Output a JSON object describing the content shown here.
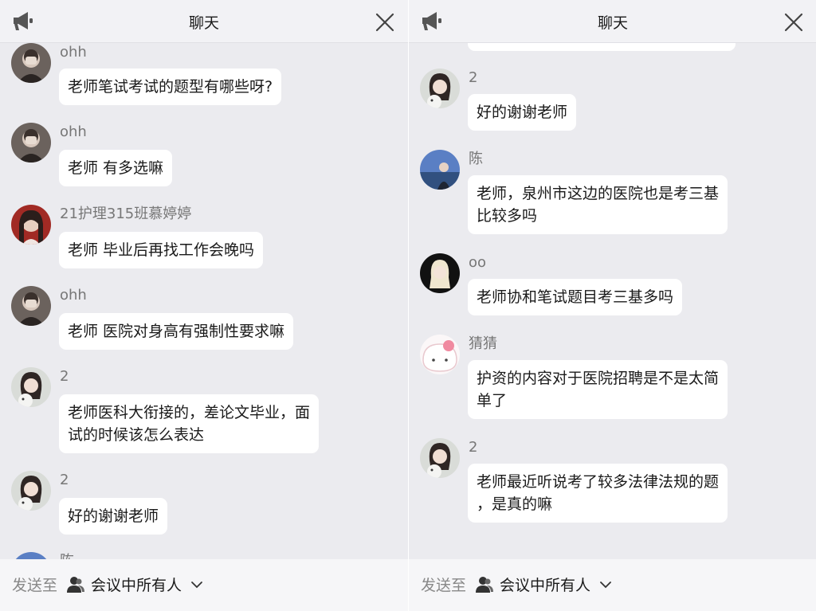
{
  "left_panel": {
    "header": {
      "title": "聊天"
    },
    "messages": [
      {
        "sender": "ohh",
        "lines": [
          "老师笔试考试的题型有哪些呀?"
        ]
      },
      {
        "sender": "ohh",
        "lines": [
          "老师 有多选嘛"
        ]
      },
      {
        "sender": "21护理315班慕婷婷",
        "lines": [
          "老师 毕业后再找工作会晚吗"
        ]
      },
      {
        "sender": "ohh",
        "lines": [
          "老师 医院对身高有强制性要求嘛"
        ]
      },
      {
        "sender": "2",
        "lines": [
          "老师医科大衔接的，差论文毕业，面",
          "试的时候该怎么表达"
        ]
      },
      {
        "sender": "2",
        "lines": [
          "好的谢谢老师"
        ]
      },
      {
        "sender": "陈",
        "lines": []
      }
    ],
    "footer": {
      "send_to_label": "发送至",
      "target": "会议中所有人"
    }
  },
  "right_panel": {
    "header": {
      "title": "聊天"
    },
    "messages": [
      {
        "sender": "2",
        "lines": [
          "好的谢谢老师"
        ]
      },
      {
        "sender": "陈",
        "lines": [
          "老师，泉州市这边的医院也是考三基",
          "比较多吗"
        ]
      },
      {
        "sender": "oo",
        "lines": [
          "老师协和笔试题目考三基多吗"
        ]
      },
      {
        "sender": "猜猜",
        "lines": [
          "护资的内容对于医院招聘是不是太简",
          "单了"
        ]
      },
      {
        "sender": "2",
        "lines": [
          "老师最近听说考了较多法律法规的题",
          "，是真的嘛"
        ]
      }
    ],
    "footer": {
      "send_to_label": "发送至",
      "target": "会议中所有人"
    }
  },
  "icons": {
    "header_left": "megaphone-icon",
    "header_right": "close-icon",
    "footer_person": "person-icon",
    "footer_chevron": "chevron-down-icon"
  },
  "colors": {
    "panel_bg": "#ebebef",
    "bubble_bg": "#ffffff",
    "sender_text": "#777777",
    "header_bg": "#f2f2f5"
  }
}
